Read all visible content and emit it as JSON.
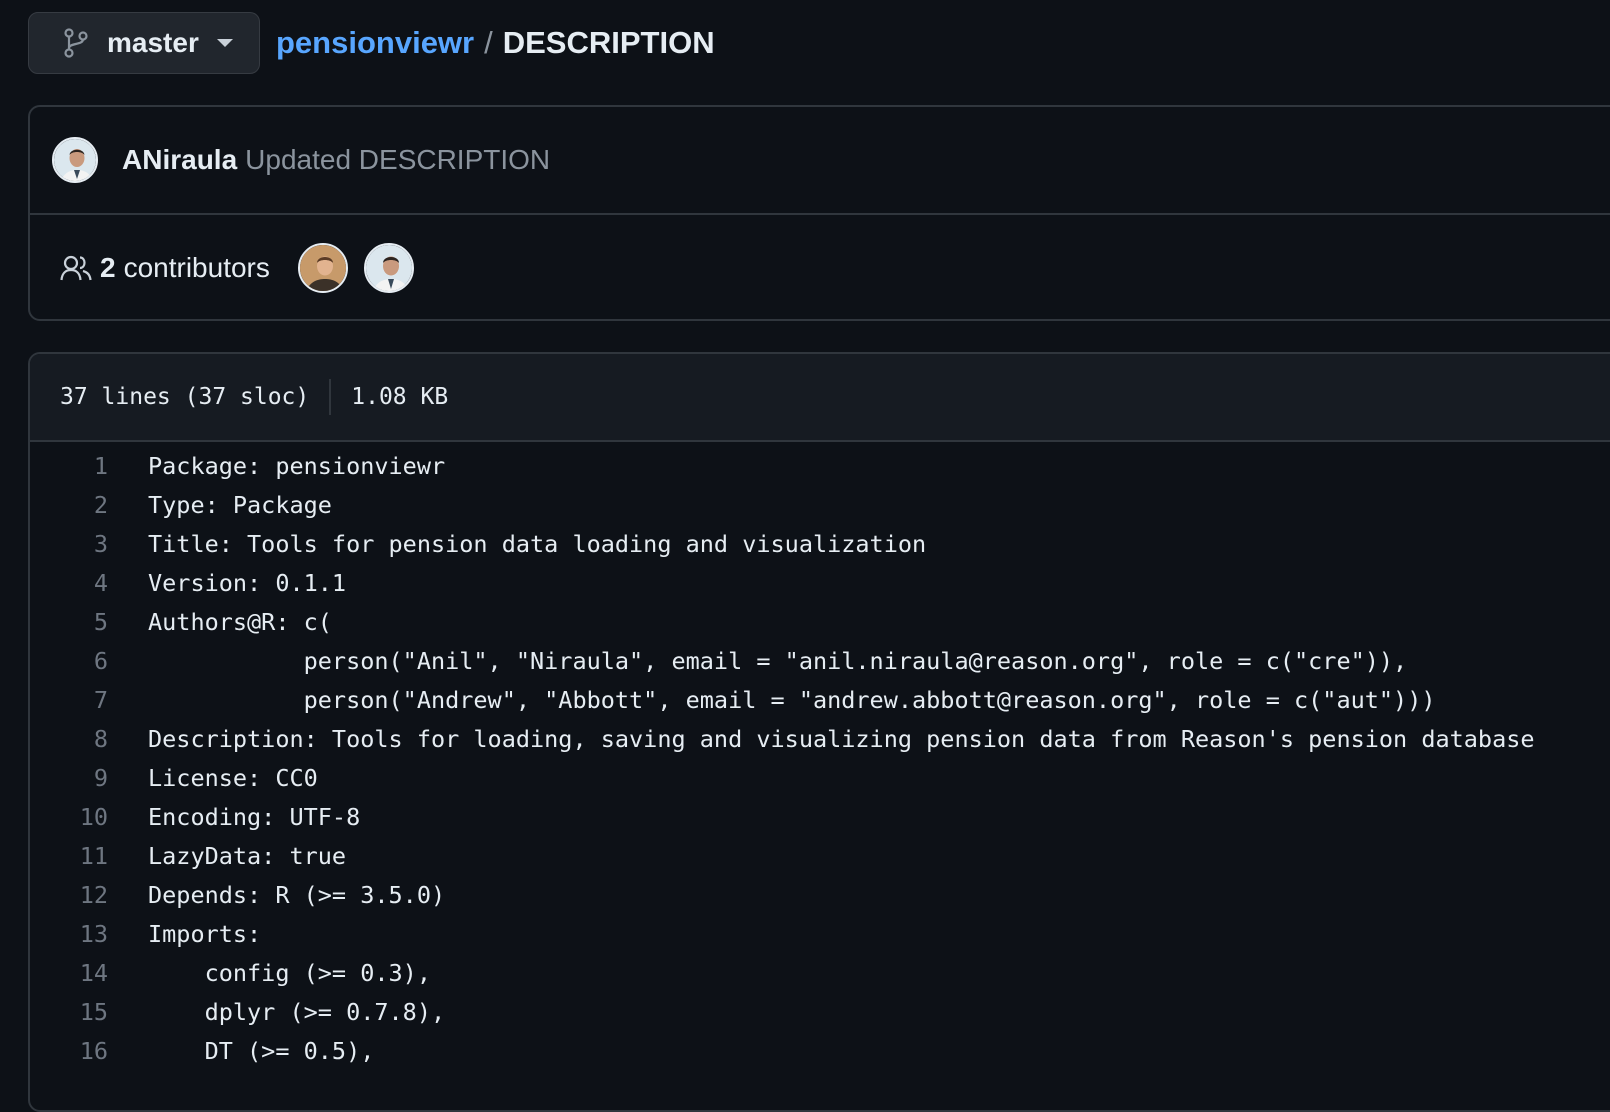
{
  "branch": {
    "name": "master"
  },
  "breadcrumb": {
    "repo": "pensionviewr",
    "separator": "/",
    "file": "DESCRIPTION"
  },
  "commit": {
    "author": "ANiraula",
    "message": "Updated DESCRIPTION"
  },
  "contributors": {
    "count": "2",
    "label": "contributors"
  },
  "file_info": {
    "lines": "37 lines (37 sloc)",
    "size": "1.08 KB"
  },
  "code_lines": [
    {
      "n": "1",
      "t": "Package: pensionviewr"
    },
    {
      "n": "2",
      "t": "Type: Package"
    },
    {
      "n": "3",
      "t": "Title: Tools for pension data loading and visualization"
    },
    {
      "n": "4",
      "t": "Version: 0.1.1"
    },
    {
      "n": "5",
      "t": "Authors@R: c("
    },
    {
      "n": "6",
      "t": "           person(\"Anil\", \"Niraula\", email = \"anil.niraula@reason.org\", role = c(\"cre\")),"
    },
    {
      "n": "7",
      "t": "           person(\"Andrew\", \"Abbott\", email = \"andrew.abbott@reason.org\", role = c(\"aut\")))"
    },
    {
      "n": "8",
      "t": "Description: Tools for loading, saving and visualizing pension data from Reason's pension database"
    },
    {
      "n": "9",
      "t": "License: CC0"
    },
    {
      "n": "10",
      "t": "Encoding: UTF-8"
    },
    {
      "n": "11",
      "t": "LazyData: true"
    },
    {
      "n": "12",
      "t": "Depends: R (>= 3.5.0)"
    },
    {
      "n": "13",
      "t": "Imports:"
    },
    {
      "n": "14",
      "t": "    config (>= 0.3),"
    },
    {
      "n": "15",
      "t": "    dplyr (>= 0.7.8),"
    },
    {
      "n": "16",
      "t": "    DT (>= 0.5),"
    }
  ]
}
